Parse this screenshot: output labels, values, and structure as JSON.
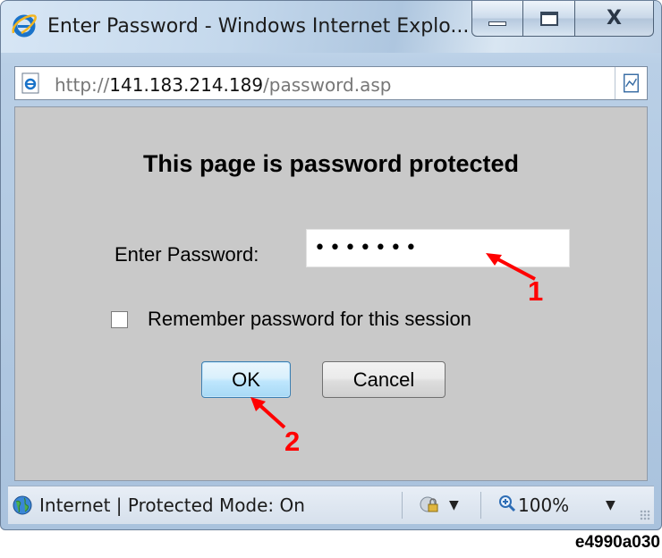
{
  "window": {
    "title": "Enter Password - Windows Internet Explo...",
    "controls": {
      "close_glyph": "X"
    }
  },
  "address": {
    "prefix": "http://",
    "host": "141.183.214.189",
    "path": "/password.asp"
  },
  "page": {
    "heading": "This page is password protected",
    "password_label": "Enter Password:",
    "password_value": "•••••••",
    "remember_label": "Remember password for this session",
    "remember_checked": false,
    "ok_label": "OK",
    "cancel_label": "Cancel"
  },
  "status": {
    "zone_text": "Internet | Protected Mode: On",
    "zoom_text": "100%",
    "dropdown_glyph": "▼"
  },
  "annotations": {
    "callout_1": "1",
    "callout_2": "2",
    "color": "#ff0000"
  },
  "caption": "e4990a030"
}
